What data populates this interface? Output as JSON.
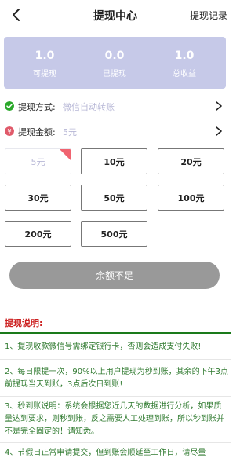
{
  "header": {
    "title": "提现中心",
    "record_label": "提现记录",
    "back_icon": "back-arrow-icon"
  },
  "stats": [
    {
      "value": "1.0",
      "label": "可提现"
    },
    {
      "value": "0.0",
      "label": "已提现"
    },
    {
      "value": "1.0",
      "label": "总收益"
    }
  ],
  "method": {
    "label": "提现方式:",
    "value": "微信自动转账",
    "icon": "check-circle-icon",
    "icon_color": "#2aa82a"
  },
  "amount": {
    "label": "提现金额:",
    "value": "5元",
    "icon": "yen-coin-icon",
    "icon_color": "#e05a6a"
  },
  "amount_options": [
    "5元",
    "10元",
    "20元",
    "30元",
    "50元",
    "100元",
    "200元",
    "500元"
  ],
  "selected_amount": "5元",
  "submit_label": "余额不足",
  "notes": {
    "title": "提现说明:",
    "items": [
      "1、提现收款微信号需绑定银行卡，否则会造成支付失败!",
      "2、每日限提一次，90%以上用户提现为秒到账，其余的下午3点前提现当天到账，3点后次日到账!",
      "3、秒到账说明：系统会根据您近几天的数据进行分析，如果质量达到要求，则秒到账，反之需要人工处理到账，所以秒到账并不是完全固定的！请知悉。",
      "4、节假日正常申请提交，但到账会顺延至工作日，请尽量"
    ]
  },
  "colors": {
    "stats_bg": "#c6c9e8",
    "accent_muted": "#b7b7d6",
    "note_text": "#2f7a2f",
    "note_title": "#cc1f1f",
    "submit_bg": "#999999"
  }
}
